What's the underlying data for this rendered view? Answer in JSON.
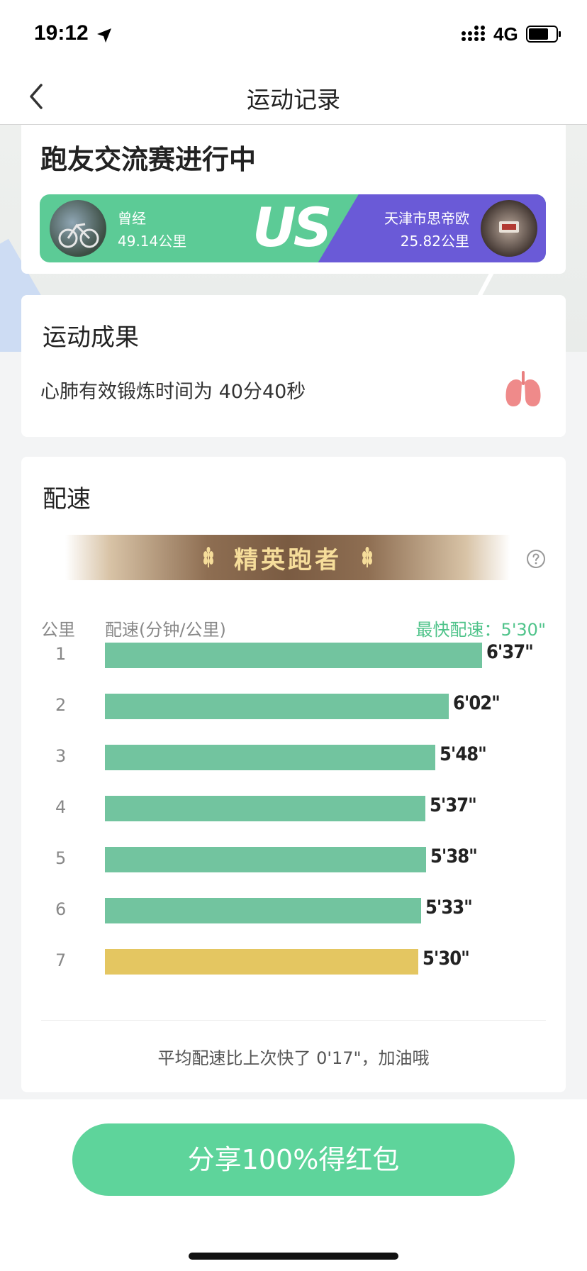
{
  "status_bar": {
    "time": "19:12",
    "network": "4G",
    "battery_level": 0.72
  },
  "nav": {
    "title": "运动记录",
    "back_icon": "chevron-left-icon"
  },
  "race": {
    "title": "跑友交流赛进行中",
    "vs_label": "US",
    "left_runner": {
      "name": "曾经",
      "distance": "49.14公里"
    },
    "right_runner": {
      "name": "天津市思帝欧",
      "distance": "25.82公里"
    },
    "colors": {
      "left": "#5ccb96",
      "right": "#6a5ad7"
    }
  },
  "result": {
    "title": "运动成果",
    "text": "心肺有效锻炼时间为 40分40秒",
    "icon": "lungs-icon"
  },
  "pace": {
    "title": "配速",
    "badge": "精英跑者",
    "col_km": "公里",
    "col_pace": "配速(分钟/公里)",
    "fastest": "最快配速：5'30\"",
    "summary": "平均配速比上次快了 0'17\"，加油哦",
    "colors": {
      "normal": "#72c49f",
      "fastest": "#e4c661"
    }
  },
  "chart_data": {
    "type": "bar",
    "orientation": "horizontal",
    "categories": [
      "1",
      "2",
      "3",
      "4",
      "5",
      "6",
      "7"
    ],
    "values_seconds": [
      397,
      362,
      348,
      337,
      338,
      333,
      330
    ],
    "labels": [
      "6'37\"",
      "6'02\"",
      "5'48\"",
      "5'37\"",
      "5'38\"",
      "5'33\"",
      "5'30\""
    ],
    "highlight_index": 6
  },
  "share": {
    "label": "分享100%得红包"
  }
}
